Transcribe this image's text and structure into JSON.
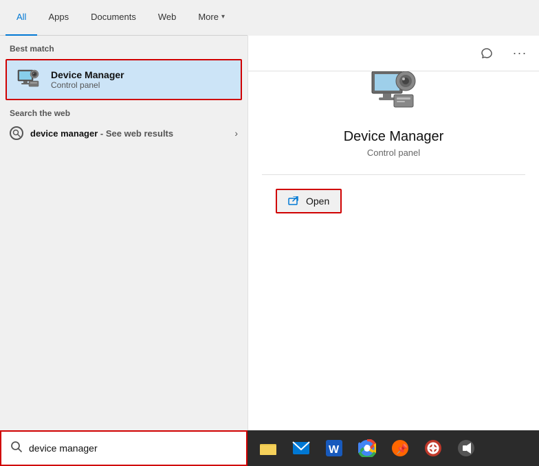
{
  "tabs": [
    {
      "id": "all",
      "label": "All",
      "active": true
    },
    {
      "id": "apps",
      "label": "Apps",
      "active": false
    },
    {
      "id": "documents",
      "label": "Documents",
      "active": false
    },
    {
      "id": "web",
      "label": "Web",
      "active": false
    },
    {
      "id": "more",
      "label": "More",
      "active": false
    }
  ],
  "header": {
    "feedback_tooltip": "Send feedback",
    "more_tooltip": "More options"
  },
  "best_match": {
    "section_label": "Best match",
    "item": {
      "title": "Device Manager",
      "subtitle": "Control panel"
    }
  },
  "web_search": {
    "section_label": "Search the web",
    "query": "device manager",
    "suffix": "- See web results"
  },
  "right_panel": {
    "app_title": "Device Manager",
    "app_subtitle": "Control panel",
    "open_label": "Open"
  },
  "search_bar": {
    "placeholder": "device manager",
    "value": "device manager"
  },
  "taskbar": {
    "icons": [
      {
        "name": "file-explorer",
        "symbol": "📁"
      },
      {
        "name": "mail",
        "symbol": "✉"
      },
      {
        "name": "word",
        "symbol": "W"
      },
      {
        "name": "chrome",
        "symbol": "⬤"
      },
      {
        "name": "pin",
        "symbol": "📌"
      },
      {
        "name": "torrent",
        "symbol": "⚙"
      },
      {
        "name": "audio",
        "symbol": "🔊"
      }
    ]
  },
  "colors": {
    "accent": "#0078d4",
    "red_border": "#d00000",
    "selected_bg": "#cce4f7",
    "taskbar_bg": "#2b2b2b"
  }
}
